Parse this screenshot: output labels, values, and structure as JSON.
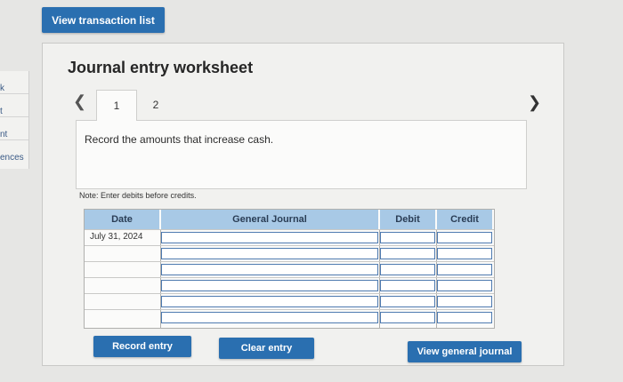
{
  "sidebar": {
    "items": [
      "k",
      "t",
      "nt",
      "ences"
    ]
  },
  "header": {
    "view_transactions_label": "View transaction list"
  },
  "worksheet": {
    "title": "Journal entry worksheet",
    "tabs": [
      {
        "label": "1",
        "active": true
      },
      {
        "label": "2",
        "active": false
      }
    ],
    "instruction": "Record the amounts that increase cash.",
    "note": "Note: Enter debits before credits."
  },
  "journal": {
    "columns": [
      "Date",
      "General Journal",
      "Debit",
      "Credit"
    ],
    "rows": [
      {
        "date": "July 31, 2024",
        "account": "",
        "debit": "",
        "credit": ""
      },
      {
        "date": "",
        "account": "",
        "debit": "",
        "credit": ""
      },
      {
        "date": "",
        "account": "",
        "debit": "",
        "credit": ""
      },
      {
        "date": "",
        "account": "",
        "debit": "",
        "credit": ""
      },
      {
        "date": "",
        "account": "",
        "debit": "",
        "credit": ""
      },
      {
        "date": "",
        "account": "",
        "debit": "",
        "credit": ""
      }
    ]
  },
  "buttons": {
    "record": "Record entry",
    "clear": "Clear entry",
    "view_general": "View general journal"
  },
  "colors": {
    "accent": "#2a6fb0",
    "header_blue": "#a8c9e6"
  },
  "icons": {
    "prev": "chevron-left-icon",
    "next": "chevron-right-icon"
  }
}
